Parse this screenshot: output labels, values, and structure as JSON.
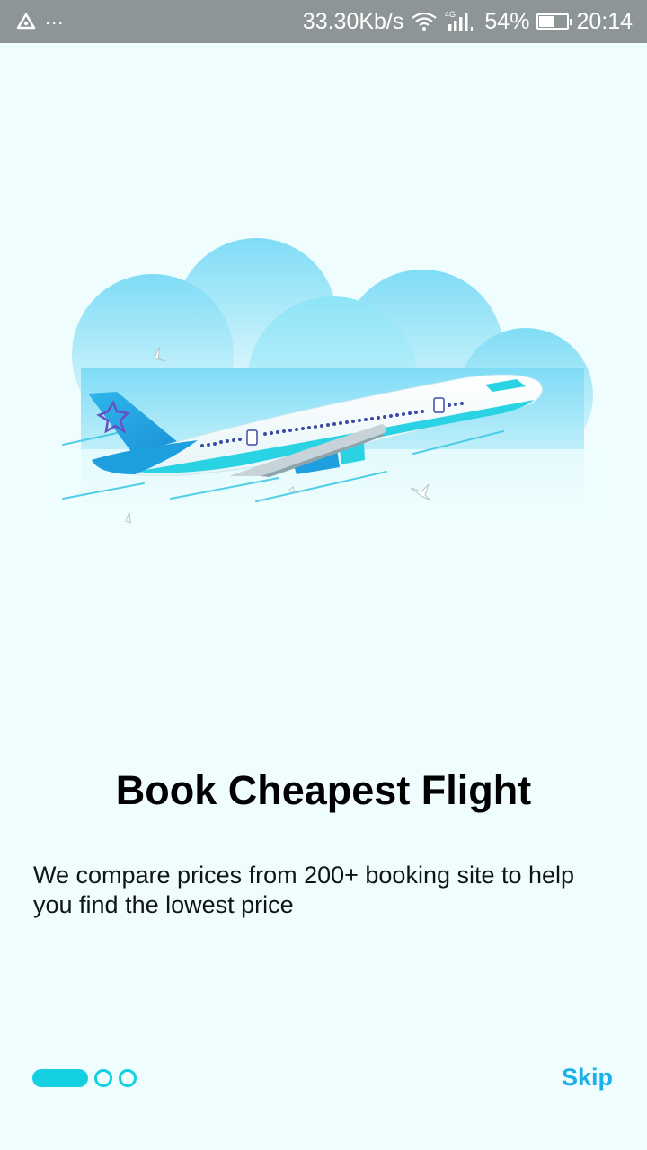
{
  "status_bar": {
    "dots": "...",
    "network_speed": "33.30Kb/s",
    "network_type": "4G",
    "battery_percent": "54%",
    "battery_level": 0.54,
    "time": "20:14",
    "icons": [
      "app-notification-icon",
      "wifi-icon",
      "cellular-signal-icon",
      "battery-icon"
    ]
  },
  "onboarding": {
    "title": "Book Cheapest Flight",
    "description": "We compare prices from 200+ booking site to help you find the lowest price",
    "illustration": "airplane-in-clouds-illustration",
    "current_page": 1,
    "total_pages": 3,
    "skip_label": "Skip"
  },
  "colors": {
    "background": "#effdfe",
    "status_bar": "#8e9596",
    "accent": "#14cfe0",
    "skip": "#1ab0e8"
  }
}
